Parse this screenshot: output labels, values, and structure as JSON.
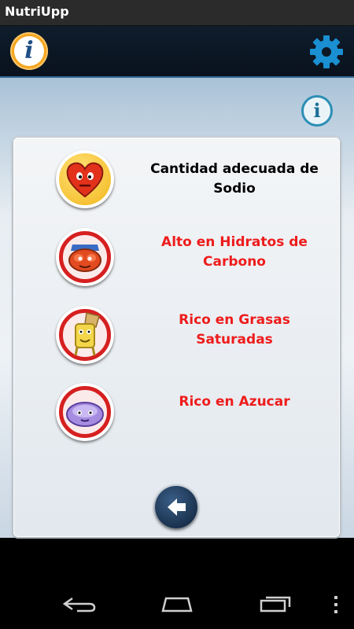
{
  "app": {
    "title": "NutriUpp"
  },
  "header": {
    "info_icon": "info-icon",
    "settings_icon": "gear-icon",
    "brand_color": "#0e4a7a",
    "accent_color": "#f4a51d"
  },
  "main": {
    "info_icon": "info-icon",
    "items": [
      {
        "label": "Cantidad adecuada de Sodio",
        "color": "#111111",
        "icon": "heart-mascot-icon",
        "ring_color": "#f2b619"
      },
      {
        "label": "Alto en Hidratos de Carbono",
        "color": "#ee1c1c",
        "icon": "bread-mascot-icon",
        "ring_color": "#d62020"
      },
      {
        "label": "Rico en Grasas Saturadas",
        "color": "#ee1c1c",
        "icon": "fries-mascot-icon",
        "ring_color": "#d62020"
      },
      {
        "label": "Rico en Azucar",
        "color": "#ee1c1c",
        "icon": "candy-mascot-icon",
        "ring_color": "#d62020"
      }
    ],
    "back_icon": "arrow-left-icon"
  },
  "navbar": {
    "back": "back-nav-icon",
    "home": "home-nav-icon",
    "recents": "recents-nav-icon",
    "menu": "overflow-menu-icon"
  }
}
